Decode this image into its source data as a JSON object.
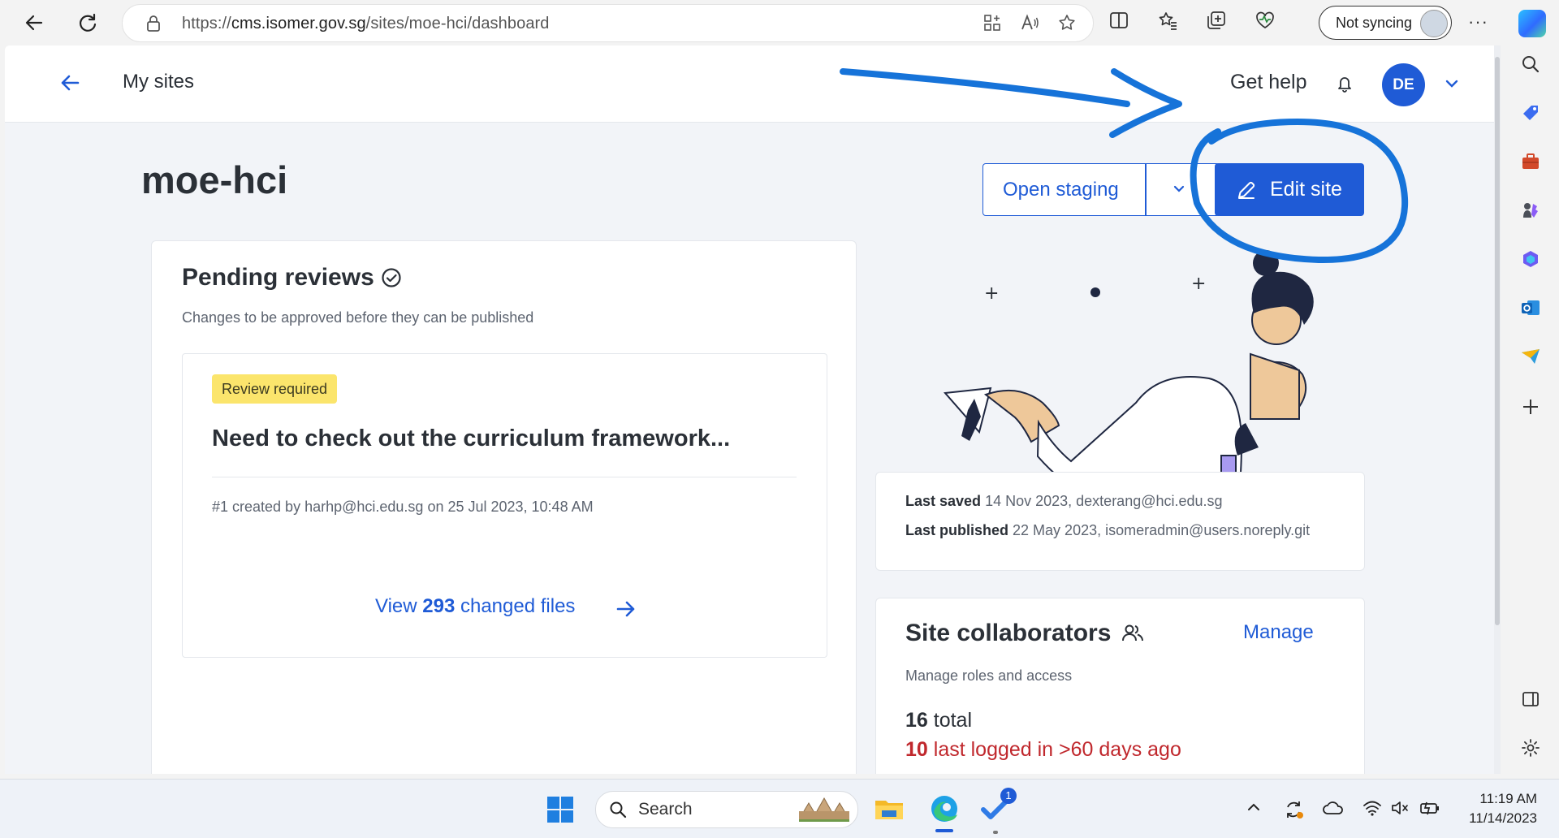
{
  "browser": {
    "url_prefix": "https://",
    "url_host": "cms.isomer.gov.sg",
    "url_path": "/sites/moe-hci/dashboard",
    "sync_label": "Not syncing",
    "more_label": "···"
  },
  "header": {
    "back_label": "My sites",
    "help_label": "Get help",
    "avatar_initials": "DE"
  },
  "site": {
    "name": "moe-hci",
    "open_staging_label": "Open staging",
    "edit_site_label": "Edit site"
  },
  "pending": {
    "title": "Pending reviews",
    "subtitle": "Changes to be approved before they can be published",
    "badge": "Review required",
    "review_title": "Need to check out the curriculum framework...",
    "review_meta": "#1 created by harhp@hci.edu.sg on 25 Jul 2023, 10:48 AM",
    "view_prefix": "View ",
    "view_count": "293",
    "view_suffix": " changed files"
  },
  "saved": {
    "last_saved_label": "Last saved",
    "last_saved_value": "14 Nov 2023, dexterang@hci.edu.sg",
    "last_published_label": "Last published",
    "last_published_value": "22 May 2023, isomeradmin@users.noreply.git"
  },
  "collaborators": {
    "title": "Site collaborators",
    "manage_label": "Manage",
    "subtitle": "Manage roles and access",
    "total_count": "16",
    "total_label": " total",
    "inactive_count": "10",
    "inactive_label": " last logged in >60 days ago"
  },
  "taskbar": {
    "search_label": "Search",
    "todo_badge": "1",
    "time": "11:19 AM",
    "date": "11/14/2023"
  },
  "colors": {
    "primary": "#1f5bd6",
    "badge_yellow": "#fbe56c",
    "danger": "#c0282d",
    "annotation_blue": "#1673d9"
  }
}
